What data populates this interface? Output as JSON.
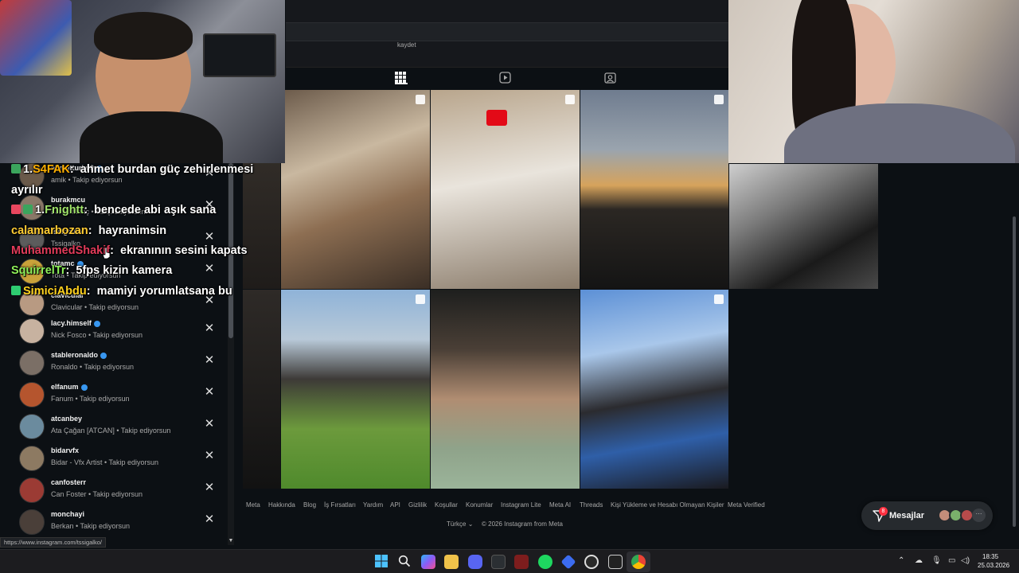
{
  "follow_list": [
    {
      "username": "ahmetturku0",
      "subtitle": "amik • Takip ediyorsun",
      "verified": true
    },
    {
      "username": "burakmcu",
      "subtitle": "Burak Meriç • Takip ediyorsun",
      "verified": false
    },
    {
      "username": "tssigalko",
      "subtitle": "Tssigalko",
      "verified": false
    },
    {
      "username": "totamc",
      "subtitle": "Tota • Takip ediyorsun",
      "verified": true
    },
    {
      "username": "clavicular",
      "subtitle": "Clavicular • Takip ediyorsun",
      "verified": false
    },
    {
      "username": "lacy.himself",
      "subtitle": "Nick Fosco • Takip ediyorsun",
      "verified": true
    },
    {
      "username": "stableronaldo",
      "subtitle": "Ronaldo • Takip ediyorsun",
      "verified": true
    },
    {
      "username": "elfanum",
      "subtitle": "Fanum • Takip ediyorsun",
      "verified": true
    },
    {
      "username": "atcanbey",
      "subtitle": "Ata Çağan [ATCAN] • Takip ediyorsun",
      "verified": false
    },
    {
      "username": "bidarvfx",
      "subtitle": "Bidar - Vfx Artist • Takip ediyorsun",
      "verified": false
    },
    {
      "username": "canfosterr",
      "subtitle": "Can Foster • Takip ediyorsun",
      "verified": false
    },
    {
      "username": "monchayi",
      "subtitle": "Berkan • Takip ediyorsun",
      "verified": false
    }
  ],
  "chat": [
    {
      "badge": "1.",
      "name": "S4FAK",
      "sep": ":",
      "text": "ahmet burdan güç zehirlenmesi",
      "color": "#ffb000"
    },
    {
      "badge": "",
      "name": "",
      "sep": "",
      "text": "ayrılır",
      "color": "#ffffff"
    },
    {
      "badge": "1.",
      "name": "Fnightt",
      "sep": ":",
      "text": "bencede abi aşık sana",
      "color": "#9fe36a"
    },
    {
      "badge": "",
      "name": "calamarbozan",
      "sep": ":",
      "text": "hayranimsin",
      "color": "#ffcc33"
    },
    {
      "badge": "",
      "name": "MuhammedShakif",
      "sep": ":",
      "text": "ekranının sesini kapats",
      "color": "#e23b5a"
    },
    {
      "badge": "",
      "name": "SquirrelTr",
      "sep": ":",
      "text": "5fps kizin kamera",
      "color": "#8ef05a"
    },
    {
      "badge": "",
      "name": "SimiciAbdu",
      "sep": ":",
      "text": "mamiyi yorumlatsana bu",
      "color": "#ffd21f"
    }
  ],
  "profile": {
    "topbar_text": "kaydet"
  },
  "footer": {
    "links": [
      "Meta",
      "Hakkında",
      "Blog",
      "İş Fırsatları",
      "Yardım",
      "API",
      "Gizlilik",
      "Koşullar",
      "Konumlar",
      "Instagram Lite",
      "Meta AI",
      "Threads",
      "Kişi Yükleme ve Hesabı Olmayan Kişiler",
      "Meta Verified"
    ],
    "language": "Türkçe",
    "copyright": "© 2026 Instagram from Meta"
  },
  "messages": {
    "label": "Mesajlar",
    "badge": "8"
  },
  "status_url": "https://www.instagram.com/tssigalko/",
  "taskbar": {
    "time": "18:35",
    "date": "25.03.2026",
    "apps": [
      "start-icon",
      "search-icon",
      "copilot-icon",
      "file-explorer-icon",
      "discord-icon",
      "terminal-icon",
      "netflix-icon",
      "spotify-icon",
      "app-icon",
      "obs-icon",
      "epic-icon",
      "chrome-icon"
    ]
  },
  "colors": {
    "ig_background": "#0c1014",
    "verified": "#3897f0",
    "notification": "#ff3040"
  }
}
